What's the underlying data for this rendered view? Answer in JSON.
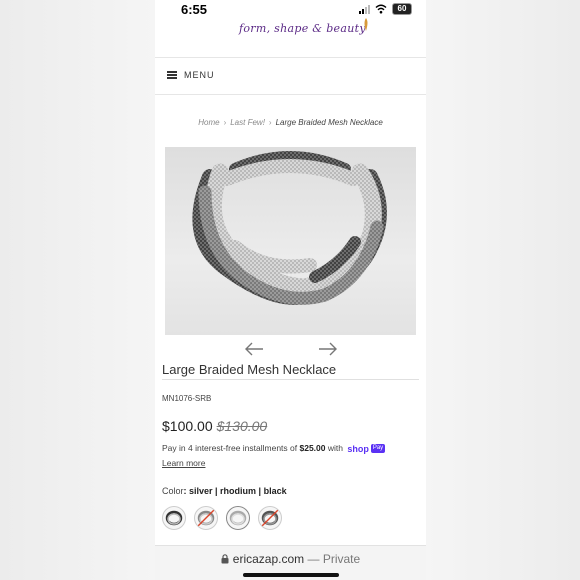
{
  "status_bar": {
    "time": "6:55",
    "battery": "60"
  },
  "store": {
    "logo_text": "form, shape & beauty"
  },
  "menu": {
    "label": "MENU"
  },
  "breadcrumb": {
    "items": [
      "Home",
      "Last Few!",
      "Large Braided Mesh Necklace"
    ]
  },
  "product": {
    "title": "Large Braided Mesh Necklace",
    "sku": "MN1076-SRB",
    "price": "$100.00",
    "compare_price": "$130.00",
    "installments": {
      "prefix": "Pay in 4 interest-free installments of ",
      "amount": "$25.00",
      "suffix": " with",
      "brand": "shop",
      "brand_badge": "Pay"
    },
    "learn_more": "Learn more",
    "color_label": "Color",
    "color_value": ": silver | rhodium | black",
    "swatches": [
      {
        "name": "black-silver",
        "available": true,
        "selected": false
      },
      {
        "name": "silver-rhodium",
        "available": false,
        "selected": false
      },
      {
        "name": "silver",
        "available": true,
        "selected": true
      },
      {
        "name": "rhodium-black",
        "available": false,
        "selected": false
      }
    ]
  },
  "browser": {
    "url": "ericazap.com",
    "separator": " — ",
    "mode": "Private"
  },
  "colors": {
    "brand_purple": "#5b2a86",
    "shop_pay": "#5a31f4",
    "text": "#333333",
    "unavailable_slash": "#d9452b"
  }
}
